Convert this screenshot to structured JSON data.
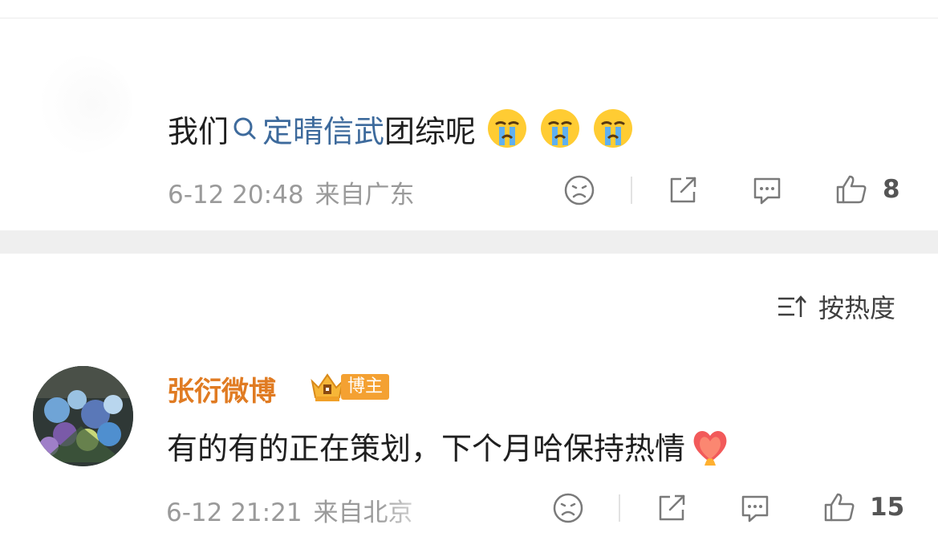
{
  "comment1": {
    "text_prefix": "我们",
    "topic": "定晴信武",
    "text_suffix": "团综呢",
    "emojis": [
      "crying-emoji",
      "crying-emoji",
      "crying-emoji"
    ],
    "date": "6-12 20:48",
    "location": "来自广东",
    "like_count": "8"
  },
  "sort": {
    "label": "按热度",
    "icon": "sort-icon"
  },
  "comment2": {
    "username": "张衍微博",
    "badge": "博主",
    "text": "有的有的正在策划，下个月哈保持热情",
    "emoji": "fire-heart-emoji",
    "date": "6-12 21:21",
    "location": "来自北京",
    "like_count": "15"
  },
  "colors": {
    "username": "#e07b22",
    "topic": "#3d6a9c",
    "meta": "#9a9a9a",
    "divider_band": "#efefef",
    "badge": "#f4a132"
  }
}
